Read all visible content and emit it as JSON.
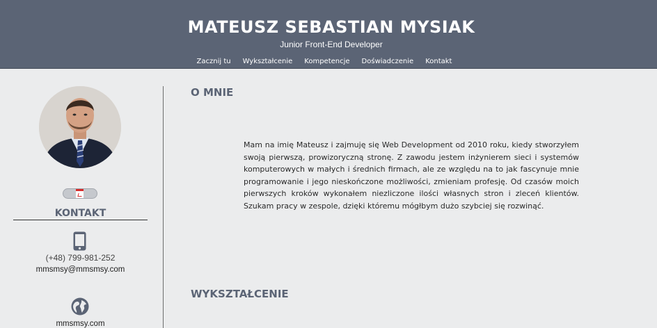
{
  "header": {
    "name": "MATEUSZ SEBASTIAN MYSIAK",
    "role": "Junior Front-End Developer"
  },
  "nav": [
    {
      "label": "Zacznij tu"
    },
    {
      "label": "Wykształcenie"
    },
    {
      "label": "Kompetencje"
    },
    {
      "label": "Doświadczenie"
    },
    {
      "label": "Kontakt"
    }
  ],
  "sidebar": {
    "cv_icon": "pdf-icon",
    "contact_title": "KONTAKT",
    "phone_icon": "phone-icon",
    "phone": "(+48) 799-981-252",
    "email": "mmsmsy@mmsmsy.com",
    "globe_icon": "globe-icon",
    "website": "mmsmsy.com"
  },
  "main": {
    "about_title": "O MNIE",
    "about_text": "Mam na imię Mateusz i zajmuję się Web Development od 2010 roku, kiedy stworzyłem swoją pierwszą, prowizoryczną stronę. Z zawodu jestem inżynierem sieci i systemów komputerowych w małych i średnich firmach, ale ze względu na to jak fascynuje mnie programowanie i jego nieskończone możliwości, zmieniam profesję. Od czasów moich pierwszych kroków wykonałem niezliczone ilości własnych stron i zleceń klientów. Szukam pracy w zespole, dzięki któremu mógłbym dużo szybciej się rozwinąć.",
    "education_title": "WYKSZTAŁCENIE"
  },
  "colors": {
    "header_bg": "#5b6475",
    "accent": "#5b6475",
    "page_bg": "#ebeced"
  }
}
